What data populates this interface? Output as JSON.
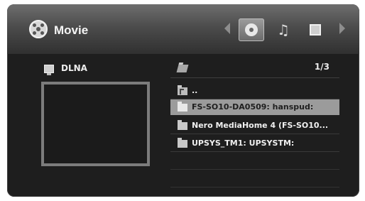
{
  "header": {
    "title": "Movie",
    "title_icon": "film-reel-icon",
    "media_tabs": [
      {
        "name": "movie",
        "icon": "film-reel-icon",
        "active": true
      },
      {
        "name": "music",
        "icon": "music-note-icon",
        "active": false
      },
      {
        "name": "photo",
        "icon": "photo-icon",
        "active": false
      }
    ]
  },
  "device": {
    "label": "DLNA",
    "icon": "network-drive-icon"
  },
  "list": {
    "header_icon": "open-folder-icon",
    "page_count": "1/3",
    "items": [
      {
        "label": "..",
        "icon": "parent-folder-icon",
        "selected": false
      },
      {
        "label": "FS-SO10-DA0509: hanspud:",
        "icon": "folder-icon",
        "selected": true
      },
      {
        "label": "Nero MediaHome 4 (FS-SO10...",
        "icon": "folder-icon",
        "selected": false
      },
      {
        "label": "UPSYS_TM1: UPSYSTM:",
        "icon": "folder-icon",
        "selected": false
      }
    ]
  },
  "colors": {
    "background": "#1e1e1e",
    "header_gradient_top": "#6e6e6e",
    "selected_row": "#9b9b9b",
    "text": "#f0f0f0"
  }
}
